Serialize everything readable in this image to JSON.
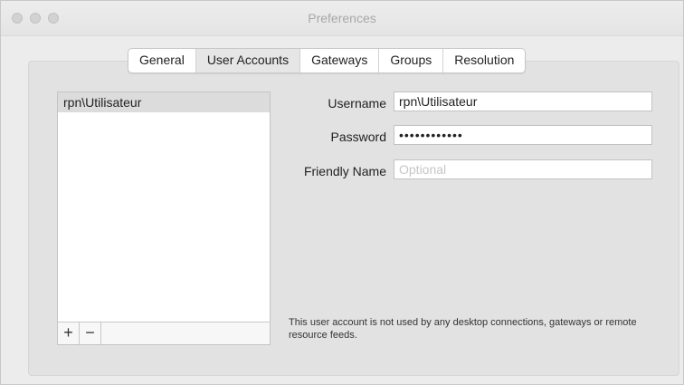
{
  "window": {
    "title": "Preferences"
  },
  "tabs": [
    {
      "label": "General",
      "selected": false
    },
    {
      "label": "User Accounts",
      "selected": true
    },
    {
      "label": "Gateways",
      "selected": false
    },
    {
      "label": "Groups",
      "selected": false
    },
    {
      "label": "Resolution",
      "selected": false
    }
  ],
  "accounts": {
    "items": [
      "rpn\\Utilisateur"
    ],
    "add": "+",
    "remove": "−"
  },
  "form": {
    "username": {
      "label": "Username",
      "value": "rpn\\Utilisateur"
    },
    "password": {
      "label": "Password",
      "value": "••••••••••••"
    },
    "friendly": {
      "label": "Friendly Name",
      "placeholder": "Optional"
    }
  },
  "note": "This user account is not used by any desktop connections, gateways or remote resource feeds."
}
